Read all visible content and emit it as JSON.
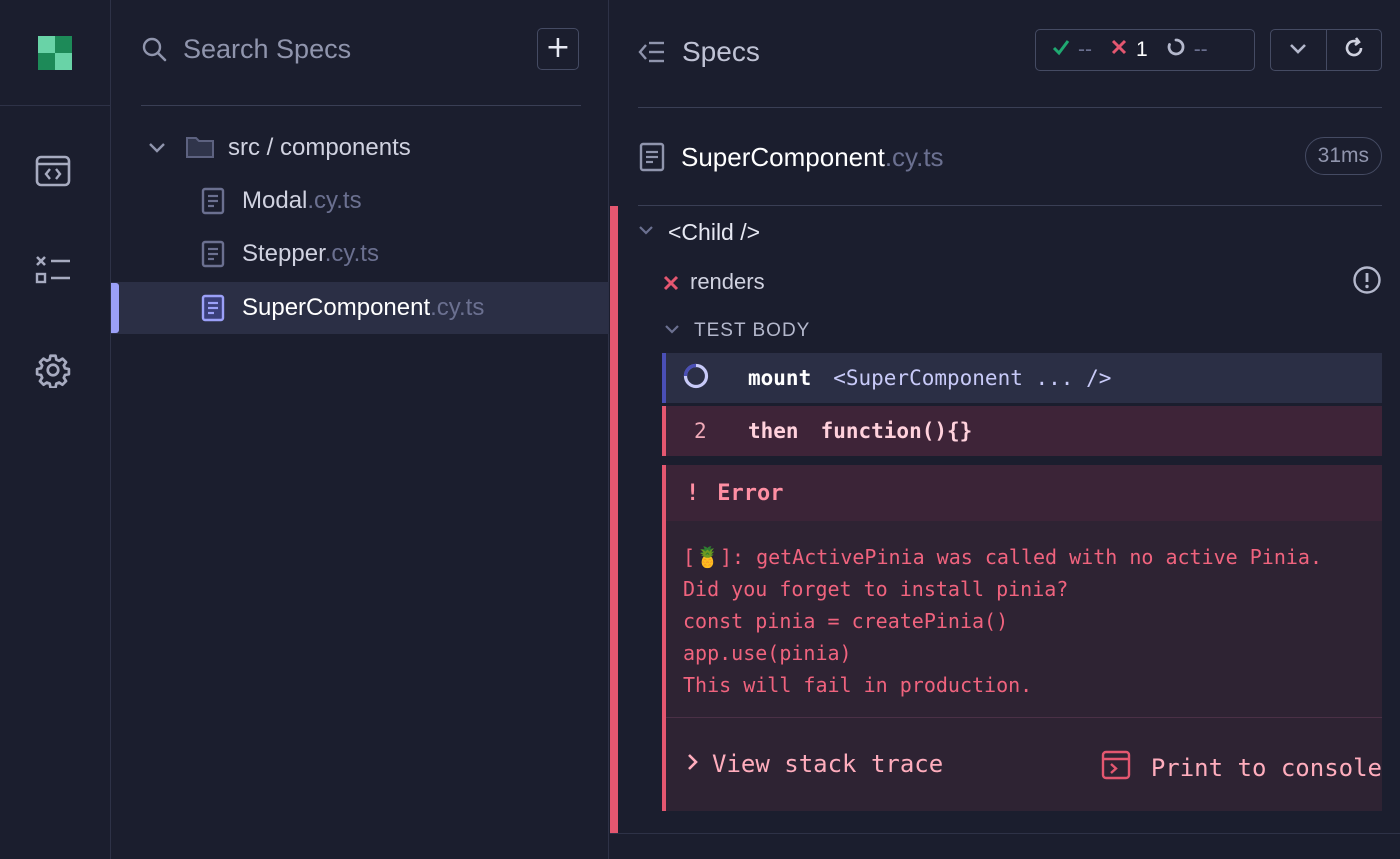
{
  "colors": {
    "background": "#1b1e2e",
    "active_row": "#2b2f45",
    "accent_indigo": "#9ba0f8",
    "fail_red": "#e45770",
    "pass_green": "#1fa971",
    "logo_green_dark": "#1d8a58",
    "logo_green_light": "#69d3a7"
  },
  "sidebar": {
    "logo_icon": "cypress-logo-icon",
    "items": [
      {
        "icon": "spec-runner-icon"
      },
      {
        "icon": "test-list-icon"
      },
      {
        "icon": "settings-gear-icon"
      }
    ]
  },
  "specs_panel": {
    "search_placeholder": "Search Specs",
    "add_label": "+",
    "folder": {
      "label": "src / components"
    },
    "files": [
      {
        "name": "Modal",
        "ext": ".cy.ts"
      },
      {
        "name": "Stepper",
        "ext": ".cy.ts"
      },
      {
        "name": "SuperComponent",
        "ext": ".cy.ts"
      }
    ]
  },
  "reporter": {
    "title": "Specs",
    "stats": {
      "passed": "--",
      "failed": "1",
      "pending": "--"
    },
    "file": {
      "name": "SuperComponent",
      "ext": ".cy.ts",
      "duration": "31ms"
    },
    "suite": {
      "title": "<Child />"
    },
    "test": {
      "title": "renders"
    },
    "test_body_label": "TEST BODY",
    "commands": [
      {
        "number": "",
        "name": "mount",
        "message": "<SuperComponent ... />"
      },
      {
        "number": "2",
        "name": "then",
        "message": "function(){}"
      }
    ],
    "error": {
      "bang": "!",
      "title": "Error",
      "message": "[🍍]: getActivePinia was called with no active Pinia.\nDid you forget to install pinia?\nconst pinia = createPinia()\napp.use(pinia)\nThis will fail in production.",
      "stack_label": "View stack trace",
      "print_label": "Print to console"
    }
  }
}
